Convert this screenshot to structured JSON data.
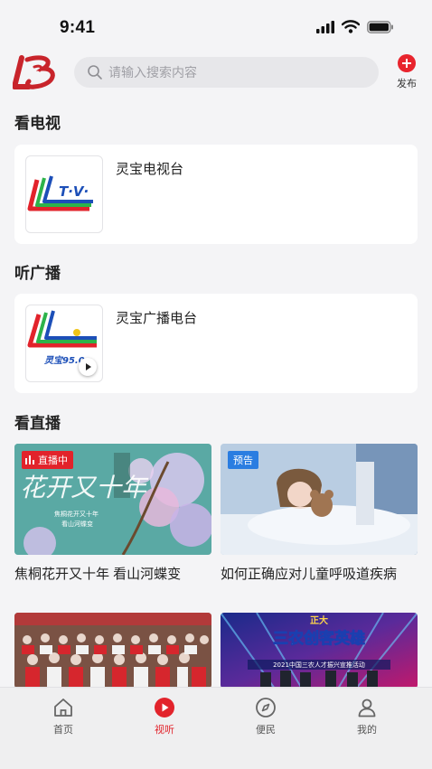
{
  "status_bar": {
    "time": "9:41"
  },
  "header": {
    "search_placeholder": "请输入搜索内容",
    "publish_label": "发布"
  },
  "sections": {
    "tv": {
      "title": "看电视",
      "channel_name": "灵宝电视台"
    },
    "radio": {
      "title": "听广播",
      "station_name": "灵宝广播电台",
      "logo_text": "灵宝95.0"
    },
    "live": {
      "title": "看直播",
      "items": [
        {
          "title": "焦桐花开又十年 看山河蝶变",
          "badge": "直播中",
          "overlay_title": "花开又十年",
          "overlay_sub1": "焦桐花开又十年",
          "overlay_sub2": "看山河蝶变"
        },
        {
          "title": "如何正确应对儿童呼吸道疾病",
          "badge": "预告"
        },
        {
          "title": ""
        },
        {
          "title": "",
          "overlay_title": "三农创客英雄",
          "overlay_top": "正大",
          "overlay_sub": "2021中国三农人才振兴宣推活动"
        }
      ]
    }
  },
  "tabbar": {
    "items": [
      {
        "label": "首页",
        "icon": "home-icon",
        "active": false
      },
      {
        "label": "视听",
        "icon": "play-circle-icon",
        "active": true
      },
      {
        "label": "便民",
        "icon": "compass-icon",
        "active": false
      },
      {
        "label": "我的",
        "icon": "person-icon",
        "active": false
      }
    ]
  },
  "colors": {
    "accent": "#e2232b",
    "preview_badge": "#2a7de1",
    "background": "#f4f4f6"
  }
}
